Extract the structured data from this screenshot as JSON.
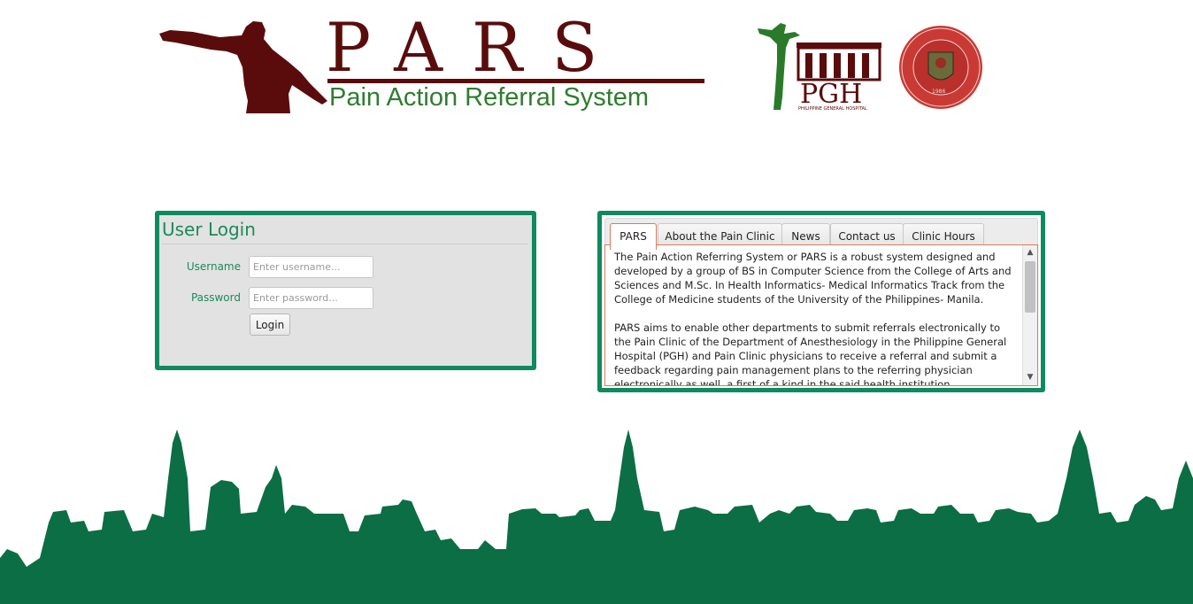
{
  "header": {
    "title": "PARS",
    "subtitle": "Pain Action Referral System"
  },
  "login": {
    "title": "User Login",
    "username_label": "Username",
    "username_placeholder": "Enter username...",
    "password_label": "Password",
    "password_placeholder": "Enter password...",
    "button_label": "Login"
  },
  "info": {
    "tabs": [
      {
        "label": "PARS"
      },
      {
        "label": "About the Pain Clinic"
      },
      {
        "label": "News"
      },
      {
        "label": "Contact us"
      },
      {
        "label": "Clinic Hours"
      }
    ],
    "active_tab": "PARS",
    "paragraphs": [
      "The Pain Action Referring System or PARS is a robust system designed and developed by a group of BS in Computer Science from the College of Arts and Sciences and M.Sc. In Health Informatics- Medical Informatics Track from the College of Medicine students of the University of the Philippines- Manila.",
      "PARS aims to enable other departments to submit referrals electronically to the Pain Clinic of the Department of Anesthesiology in the Philippine General Hospital (PGH) and Pain Clinic physicians to receive a referral and submit a feedback regarding pain management plans to the referring physician electronically as well, a first of a kind in the said health institution."
    ]
  },
  "logos": {
    "pgh_text": "PGH",
    "pgh_caption": "PHILIPPINE GENERAL HOSPITAL",
    "seal_year": "1986"
  },
  "colors": {
    "maroon": "#5a0c0c",
    "green_text": "#2f7d2f",
    "panel_border": "#0f8a5f",
    "skyline": "#0b6e45"
  }
}
